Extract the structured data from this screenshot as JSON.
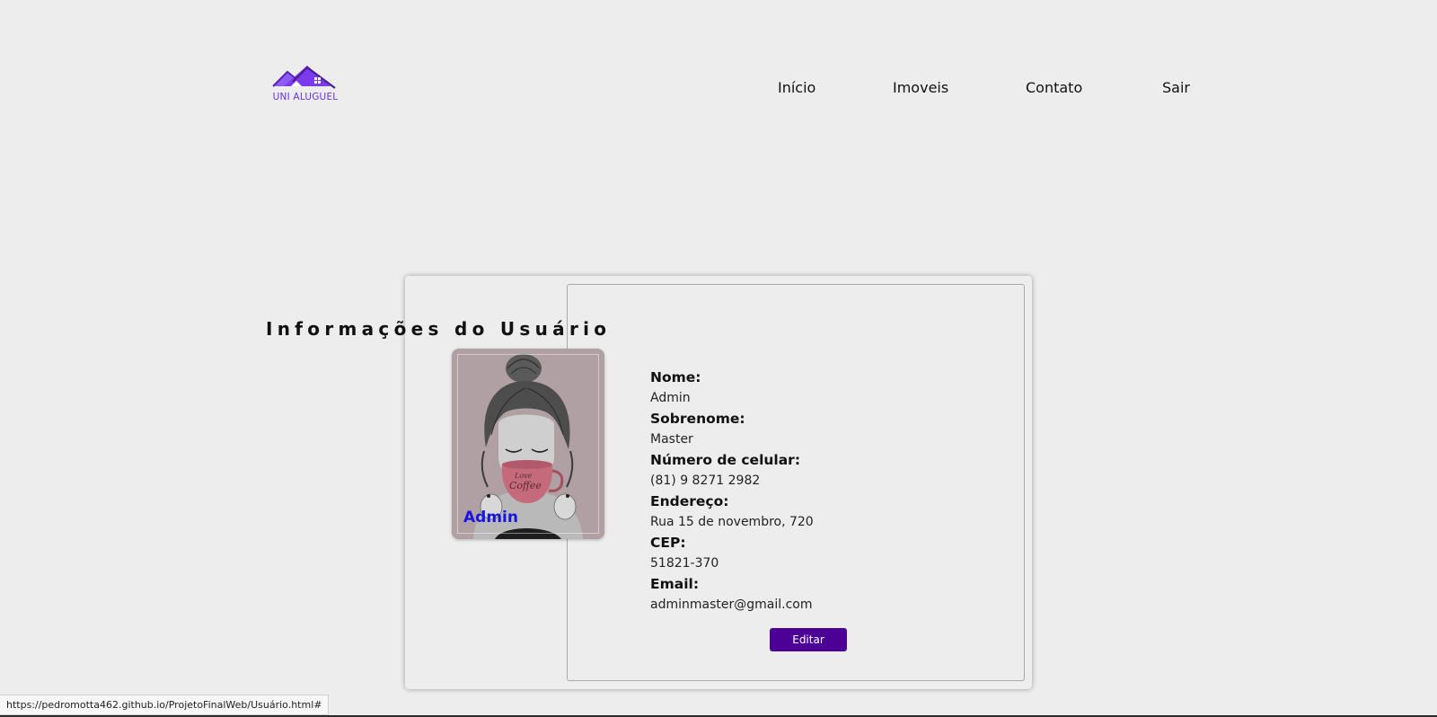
{
  "header": {
    "logo_text": "UNI ALUGUEL",
    "nav": [
      "Início",
      "Imoveis",
      "Contato",
      "Sair"
    ]
  },
  "profile": {
    "avatar_name": "Admin",
    "title": "Informações do Usuário",
    "fields": [
      {
        "label": "Nome:",
        "value": "Admin"
      },
      {
        "label": "Sobrenome:",
        "value": "Master"
      },
      {
        "label": "Número de celular:",
        "value": "(81) 9 8271 2982"
      },
      {
        "label": "Endereço:",
        "value": "Rua 15 de novembro, 720"
      },
      {
        "label": "CEP:",
        "value": "51821-370"
      },
      {
        "label": "Email:",
        "value": "adminmaster@gmail.com"
      }
    ],
    "edit_label": "Editar"
  },
  "status_bar": {
    "url": "https://pedromotta462.github.io/ProjetoFinalWeb/Usuário.html#"
  },
  "colors": {
    "background": "#ededed",
    "brand": "#6a32d6",
    "button": "#4b0096",
    "avatar_name": "#1a14e0"
  }
}
